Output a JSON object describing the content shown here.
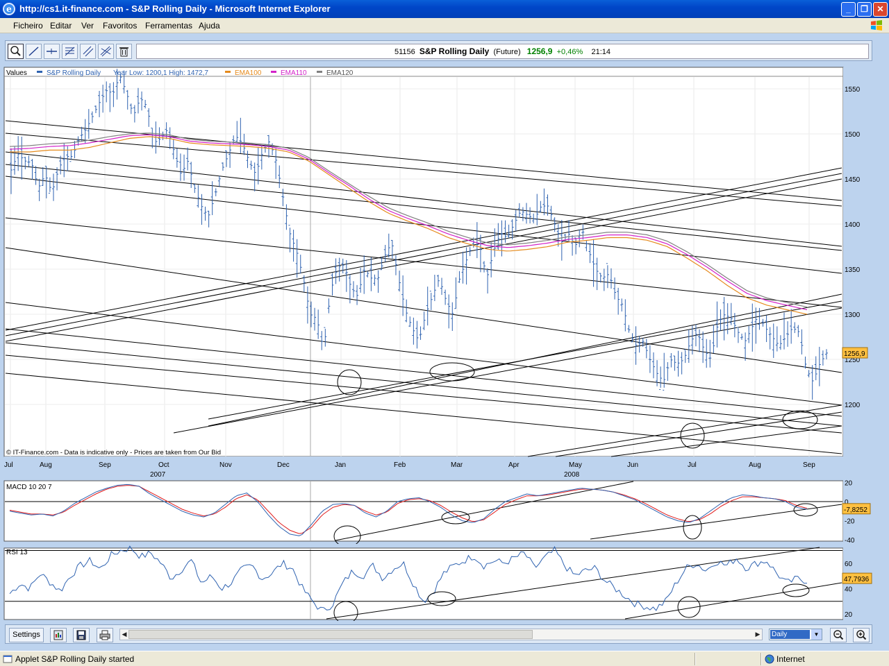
{
  "window": {
    "title": "http://cs1.it-finance.com - S&P Rolling Daily - Microsoft Internet Explorer",
    "buttons": [
      "_",
      "❐",
      "✕"
    ]
  },
  "menu": [
    "Ficheiro",
    "Editar",
    "Ver",
    "Favoritos",
    "Ferramentas",
    "Ajuda"
  ],
  "toolbar": {
    "tools": [
      "zoom-tool",
      "trendline-tool",
      "horizontal-line-tool",
      "fibonacci-tool",
      "channel-tool",
      "parallel-lines-tool",
      "delete-tool"
    ]
  },
  "instrument": {
    "code": "51156",
    "name": "S&P Rolling Daily",
    "type": "(Future)",
    "price": "1256,9",
    "change": "+0,46%",
    "time": "21:14"
  },
  "main_chart": {
    "legend": {
      "values_label": "Values",
      "series_label": "S&P Rolling Daily",
      "year_range": "Year Low: 1200,1 High: 1472,7",
      "ema100": "EMA100",
      "ema110": "EMA110",
      "ema120": "EMA120"
    },
    "footer_note": "© IT-Finance.com - Data is indicative only - Prices are taken from Our Bid",
    "price_badge": "1256,9",
    "months": [
      "Jul",
      "Aug",
      "Sep",
      "Oct",
      "Nov",
      "Dec",
      "Jan",
      "Feb",
      "Mar",
      "Apr",
      "May",
      "Jun",
      "Jul",
      "Aug",
      "Sep"
    ],
    "years": [
      "2007",
      "2008"
    ]
  },
  "macd": {
    "label": "MACD 10 20 7",
    "badge": "-7,8252"
  },
  "rsi": {
    "label": "RSI 13",
    "badge": "47,7936"
  },
  "bottom": {
    "settings_label": "Settings",
    "period": "Daily"
  },
  "status": {
    "text": "Applet S&P Rolling Daily started",
    "zone": "Internet"
  },
  "colors": {
    "price": "#2e62b0",
    "ema100": "#e58a1c",
    "ema110": "#d322c8",
    "ema120": "#808080",
    "macd_signal": "#e01b1b",
    "badge": "#ffc040",
    "up": "#008000"
  },
  "chart_data": [
    {
      "type": "ohlc",
      "title": "S&P Rolling Daily",
      "x_labels": [
        "Jul",
        "Aug",
        "Sep",
        "Oct",
        "Nov",
        "Dec",
        "Jan",
        "Feb",
        "Mar",
        "Apr",
        "May",
        "Jun",
        "Jul",
        "Aug",
        "Sep"
      ],
      "year_labels": [
        "2007",
        "2008"
      ],
      "ylim": [
        1175,
        1600
      ],
      "y_ticks": [
        1200,
        1250,
        1300,
        1350,
        1400,
        1450,
        1500,
        1550
      ],
      "close_approx": [
        1460,
        1478,
        1470,
        1468,
        1440,
        1455,
        1435,
        1462,
        1475,
        1475,
        1495,
        1505,
        1520,
        1535,
        1548,
        1545,
        1565,
        1545,
        1520,
        1540,
        1530,
        1490,
        1495,
        1505,
        1480,
        1455,
        1470,
        1440,
        1420,
        1408,
        1432,
        1460,
        1478,
        1498,
        1490,
        1470,
        1455,
        1480,
        1492,
        1470,
        1430,
        1390,
        1370,
        1340,
        1300,
        1295,
        1260,
        1325,
        1352,
        1355,
        1330,
        1320,
        1350,
        1340,
        1340,
        1365,
        1380,
        1340,
        1305,
        1285,
        1270,
        1300,
        1320,
        1340,
        1315,
        1300,
        1340,
        1360,
        1380,
        1375,
        1340,
        1370,
        1390,
        1385,
        1400,
        1415,
        1410,
        1405,
        1420,
        1420,
        1400,
        1380,
        1390,
        1375,
        1395,
        1370,
        1350,
        1340,
        1345,
        1320,
        1310,
        1280,
        1265,
        1270,
        1250,
        1235,
        1225,
        1250,
        1245,
        1250,
        1270,
        1280,
        1260,
        1250,
        1290,
        1300,
        1295,
        1280,
        1270,
        1285,
        1300,
        1285,
        1275,
        1265,
        1275,
        1285,
        1280,
        1240,
        1225,
        1245,
        1257
      ],
      "series": [
        {
          "name": "S&P Rolling Daily"
        },
        {
          "name": "EMA100",
          "values_approx": [
            1480,
            1480,
            1482,
            1482,
            1485,
            1490,
            1495,
            1497,
            1495,
            1490,
            1488,
            1487,
            1486,
            1484,
            1480,
            1470,
            1455,
            1440,
            1425,
            1412,
            1403,
            1395,
            1385,
            1378,
            1372,
            1370,
            1372,
            1375,
            1380,
            1382,
            1385,
            1385,
            1382,
            1375,
            1362,
            1348,
            1332,
            1318,
            1310,
            1305,
            1300
          ]
        },
        {
          "name": "EMA110",
          "values_approx": [
            1483,
            1484,
            1486,
            1487,
            1490,
            1494,
            1498,
            1499,
            1497,
            1492,
            1490,
            1489,
            1488,
            1486,
            1482,
            1472,
            1457,
            1443,
            1428,
            1415,
            1406,
            1398,
            1389,
            1382,
            1376,
            1374,
            1376,
            1379,
            1383,
            1385,
            1388,
            1388,
            1385,
            1378,
            1366,
            1352,
            1337,
            1323,
            1315,
            1310,
            1305
          ]
        },
        {
          "name": "EMA120",
          "values_approx": [
            1486,
            1487,
            1489,
            1490,
            1493,
            1497,
            1500,
            1501,
            1499,
            1494,
            1492,
            1491,
            1490,
            1488,
            1484,
            1474,
            1459,
            1445,
            1431,
            1418,
            1409,
            1401,
            1392,
            1385,
            1379,
            1377,
            1379,
            1382,
            1386,
            1388,
            1391,
            1391,
            1388,
            1381,
            1369,
            1355,
            1340,
            1326,
            1318,
            1313,
            1308
          ]
        }
      ],
      "last_price": 1256.9,
      "year_low": 1200.1,
      "year_high": 1472.7
    },
    {
      "type": "line",
      "title": "MACD 10 20 7",
      "ylim": [
        -42,
        20
      ],
      "y_ticks": [
        20,
        0,
        -20,
        -40
      ],
      "series": [
        {
          "name": "MACD",
          "values_approx": [
            -10,
            -12,
            -14,
            -13,
            -15,
            -10,
            -2,
            4,
            10,
            14,
            17,
            18,
            16,
            8,
            2,
            -4,
            -10,
            -14,
            -16,
            -12,
            -3,
            6,
            9,
            0,
            -14,
            -26,
            -34,
            -36,
            -24,
            -10,
            -3,
            -2,
            -4,
            -12,
            -16,
            -10,
            0,
            3,
            4,
            0,
            -6,
            -14,
            -20,
            -22,
            -18,
            -8,
            0,
            4,
            8,
            6,
            8,
            10,
            12,
            14,
            13,
            12,
            10,
            6,
            2,
            -4,
            -10,
            -16,
            -20,
            -22,
            -18,
            -10,
            -2,
            4,
            7,
            6,
            4,
            3,
            0,
            -6,
            -8
          ]
        },
        {
          "name": "Signal",
          "values_approx": [
            -9,
            -11,
            -13,
            -13,
            -14,
            -11,
            -4,
            2,
            8,
            13,
            16,
            17,
            16,
            10,
            4,
            -2,
            -8,
            -12,
            -15,
            -13,
            -6,
            3,
            7,
            2,
            -10,
            -22,
            -30,
            -34,
            -27,
            -14,
            -6,
            -3,
            -4,
            -10,
            -14,
            -11,
            -2,
            2,
            3,
            1,
            -4,
            -11,
            -17,
            -21,
            -19,
            -11,
            -3,
            2,
            6,
            6,
            7,
            9,
            11,
            13,
            13,
            12,
            10,
            7,
            3,
            -2,
            -8,
            -14,
            -18,
            -21,
            -19,
            -13,
            -5,
            1,
            5,
            5,
            4,
            3,
            1,
            -4,
            -7
          ]
        }
      ],
      "last_value": -7.8252
    },
    {
      "type": "line",
      "title": "RSI 13",
      "ylim": [
        15,
        76
      ],
      "y_ticks": [
        60,
        40,
        20
      ],
      "series": [
        {
          "name": "RSI 13",
          "values_approx": [
            36,
            44,
            40,
            52,
            45,
            38,
            50,
            58,
            62,
            55,
            66,
            70,
            72,
            65,
            68,
            60,
            48,
            55,
            62,
            44,
            50,
            40,
            45,
            55,
            58,
            48,
            52,
            60,
            56,
            40,
            30,
            22,
            28,
            44,
            54,
            50,
            58,
            48,
            56,
            60,
            44,
            30,
            38,
            52,
            58,
            62,
            66,
            58,
            62,
            60,
            64,
            68,
            56,
            64,
            70,
            58,
            50,
            54,
            56,
            46,
            40,
            34,
            28,
            26,
            24,
            30,
            44,
            56,
            60,
            54,
            62,
            58,
            64,
            56,
            60,
            62,
            52,
            44,
            48,
            46
          ]
        }
      ],
      "last_value": 47.7936
    }
  ]
}
